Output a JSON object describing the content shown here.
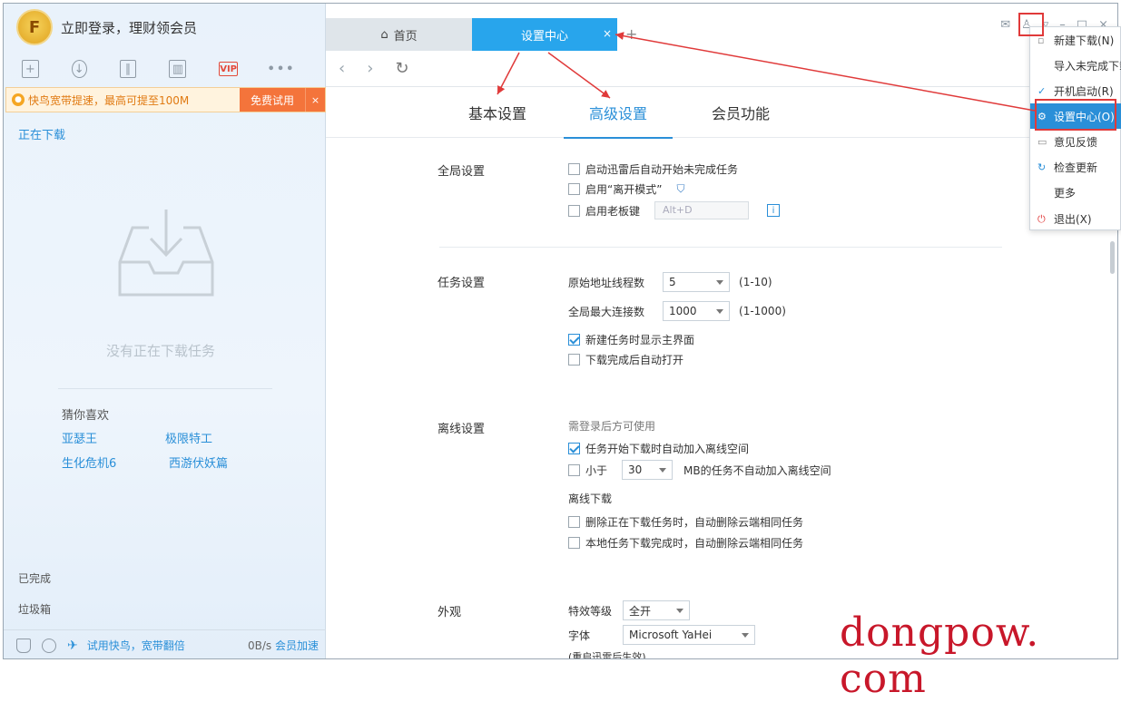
{
  "user": {
    "login_text": "立即登录，理财领会员"
  },
  "toolbar": {
    "vip_label": "VIP",
    "more_label": "•••"
  },
  "promo": {
    "text": "快鸟宽带提速，最高可提至100M",
    "button": "免费试用",
    "close": "×"
  },
  "left": {
    "downloading": "正在下载",
    "empty_text": "没有正在下载任务",
    "guess_title": "猜你喜欢",
    "recs": [
      "亚瑟王",
      "极限特工",
      "生化危机6",
      "西游伏妖篇"
    ],
    "completed": "已完成",
    "trash": "垃圾箱",
    "try_fast": "试用快鸟，宽带翻倍",
    "speed": "0B/s",
    "accelerate": "会员加速"
  },
  "tabs": {
    "home": "首页",
    "settings": "设置中心",
    "close": "×",
    "add": "+"
  },
  "settings_tabs": [
    "基本设置",
    "高级设置",
    "会员功能"
  ],
  "global": {
    "title": "全局设置",
    "auto_start": "启动迅雷后自动开始未完成任务",
    "away_mode": "启用“离开模式”",
    "boss_key": "启用老板键",
    "hotkey": "Alt+D"
  },
  "task": {
    "title": "任务设置",
    "threads_label": "原始地址线程数",
    "threads_value": "5",
    "threads_range": "(1-10)",
    "conn_label": "全局最大连接数",
    "conn_value": "1000",
    "conn_range": "(1-1000)",
    "show_main": "新建任务时显示主界面",
    "auto_open": "下载完成后自动打开"
  },
  "offline": {
    "title": "离线设置",
    "note": "需登录后方可使用",
    "auto_add": "任务开始下载时自动加入离线空间",
    "less_than": "小于",
    "size_value": "30",
    "size_text": "MB的任务不自动加入离线空间",
    "offline_dl": "离线下载",
    "del_cloud": "删除正在下载任务时，自动删除云端相同任务",
    "local_done": "本地任务下载完成时，自动删除云端相同任务"
  },
  "appearance": {
    "title": "外观",
    "effect_label": "特效等级",
    "effect_value": "全开",
    "font_label": "字体",
    "font_value": "Microsoft YaHei",
    "partial": "(重启迅雷后生效)"
  },
  "menu": {
    "items": [
      "新建下载(N)",
      "导入未完成下载",
      "开机启动(R)",
      "设置中心(O)",
      "意见反馈",
      "检查更新",
      "更多",
      "退出(X)"
    ]
  },
  "watermark": "dongpow. com"
}
